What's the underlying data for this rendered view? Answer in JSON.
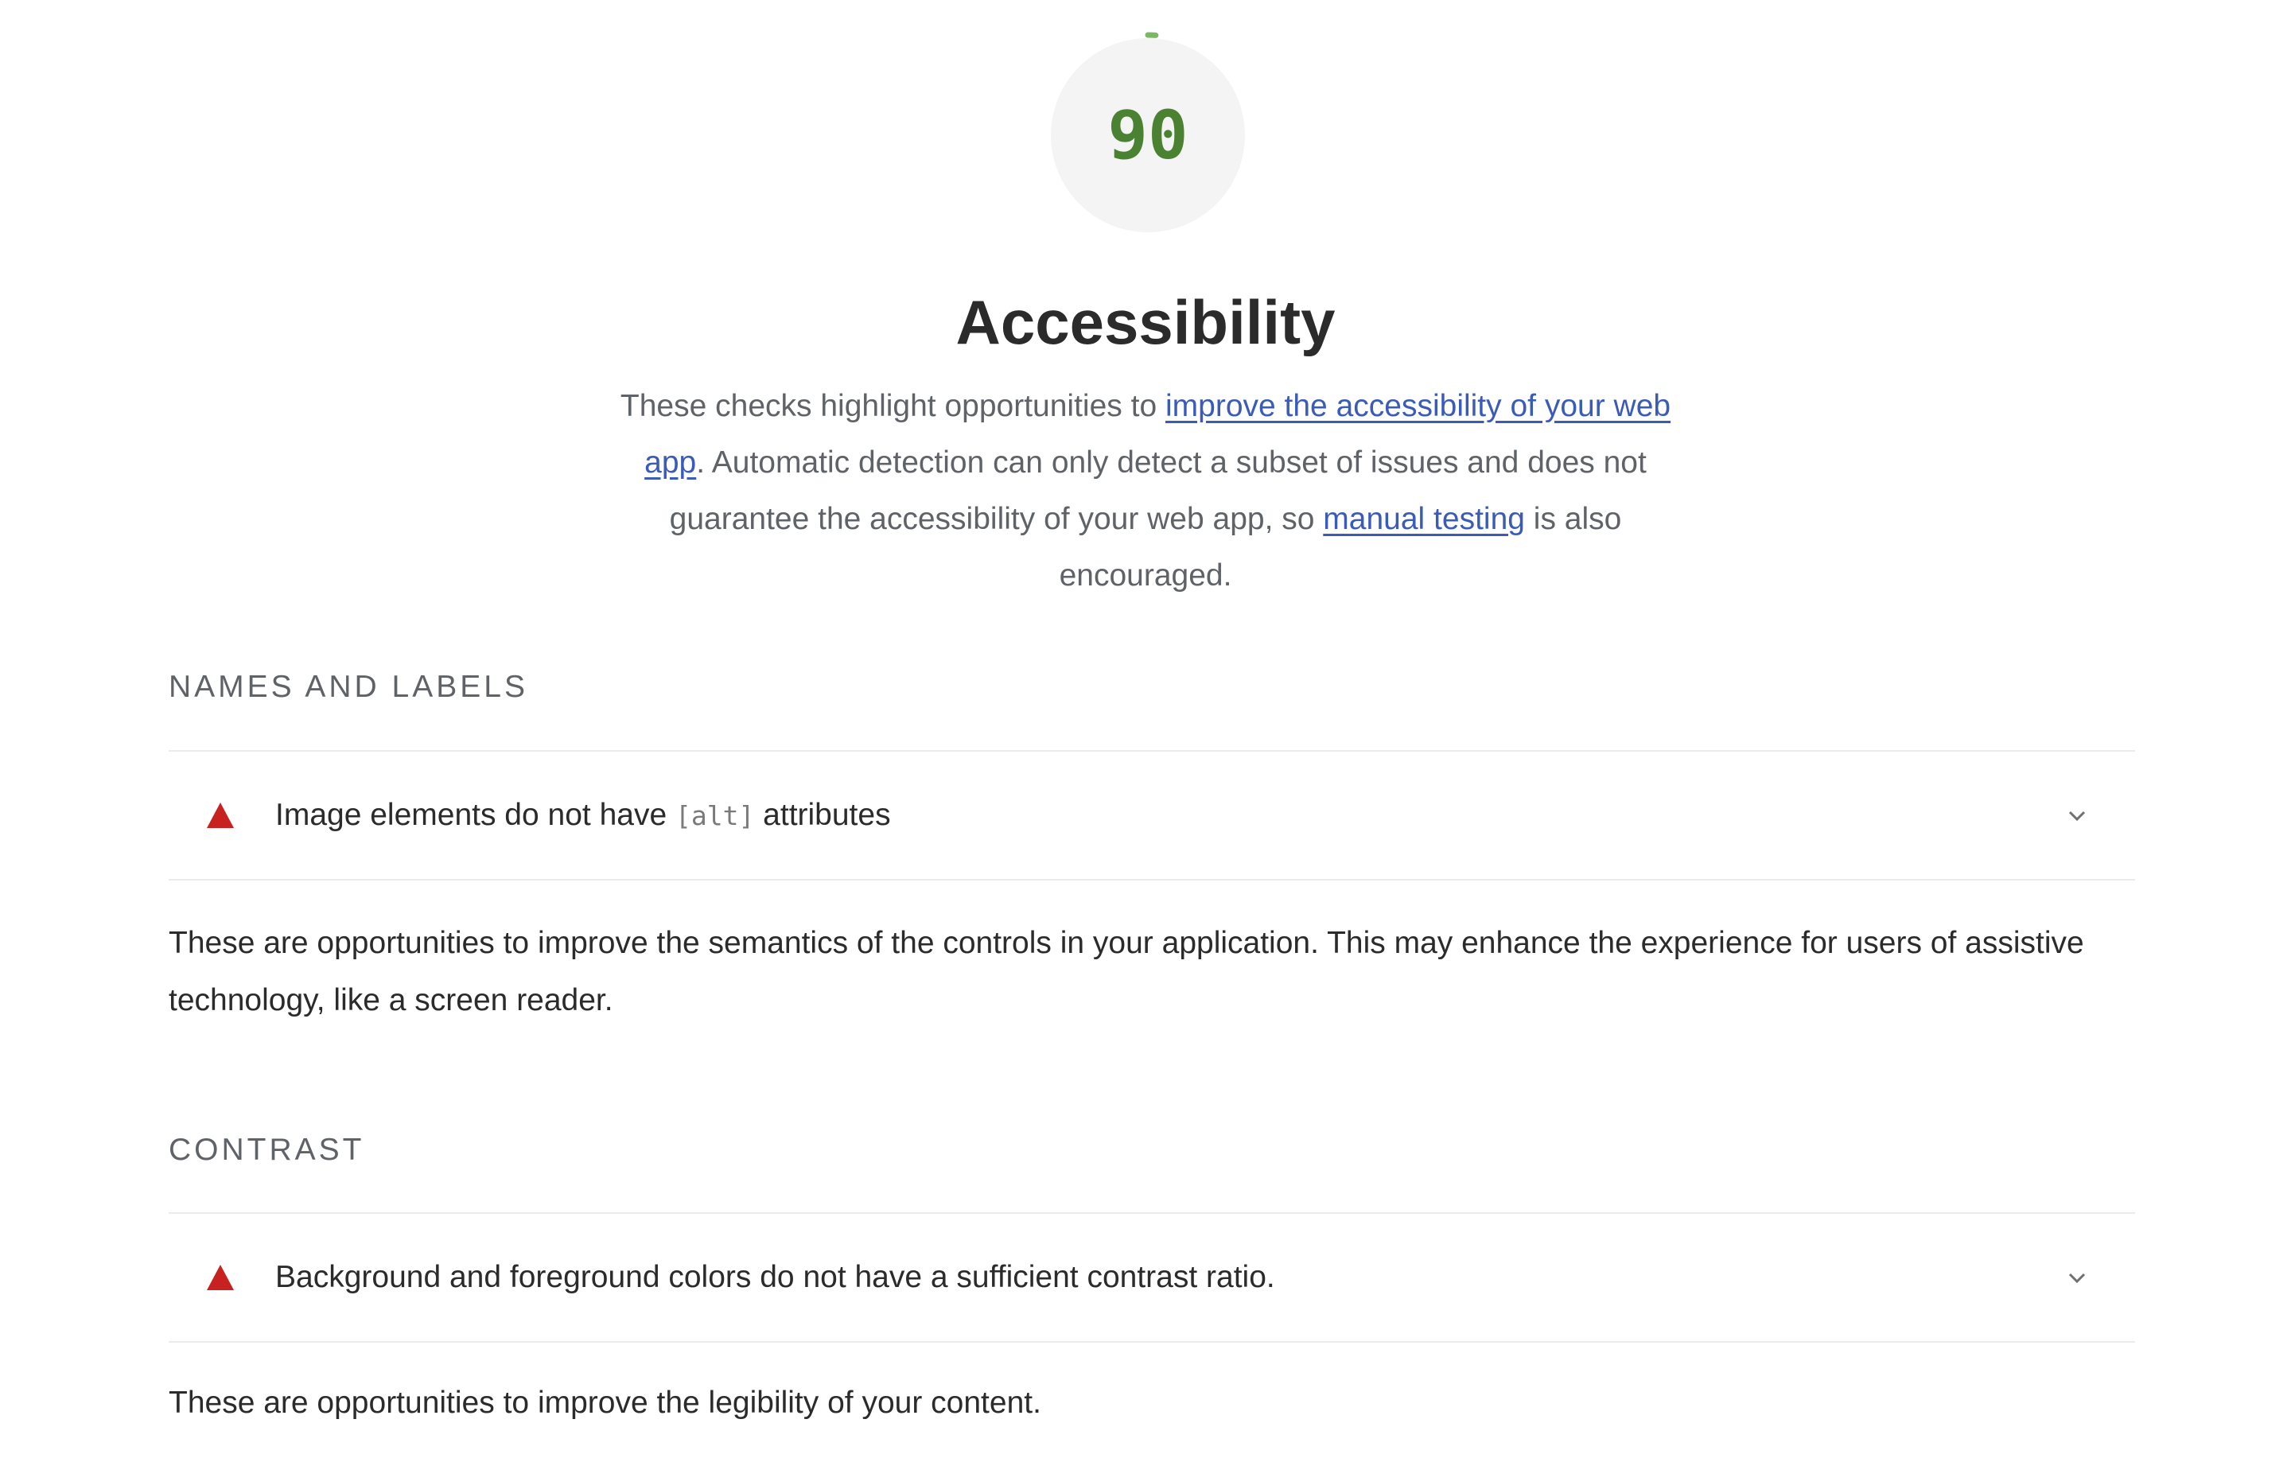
{
  "score": {
    "value": "90",
    "fraction": 0.9,
    "color": "#4b8232",
    "track_color": "#f4f4f4"
  },
  "category": {
    "title": "Accessibility",
    "description": {
      "part1": "These checks highlight opportunities to ",
      "link1": "improve the accessibility of your web app",
      "part2": ". Automatic detection can only detect a subset of issues and does not guarantee the accessibility of your web app, so ",
      "link2": "manual testing",
      "part3": " is also encouraged."
    }
  },
  "groups": [
    {
      "title": "NAMES AND LABELS",
      "audit": {
        "text_before": "Image elements do not have ",
        "code": "[alt]",
        "text_after": " attributes",
        "status": "fail",
        "icon": "warning-triangle-icon",
        "status_color": "#c7221f"
      },
      "description": "These are opportunities to improve the semantics of the controls in your application. This may enhance the experience for users of assistive technology, like a screen reader."
    },
    {
      "title": "CONTRAST",
      "audit": {
        "text_before": "Background and foreground colors do not have a sufficient contrast ratio.",
        "code": "",
        "text_after": "",
        "status": "fail",
        "icon": "warning-triangle-icon",
        "status_color": "#c7221f"
      },
      "description": "These are opportunities to improve the legibility of your content."
    }
  ]
}
